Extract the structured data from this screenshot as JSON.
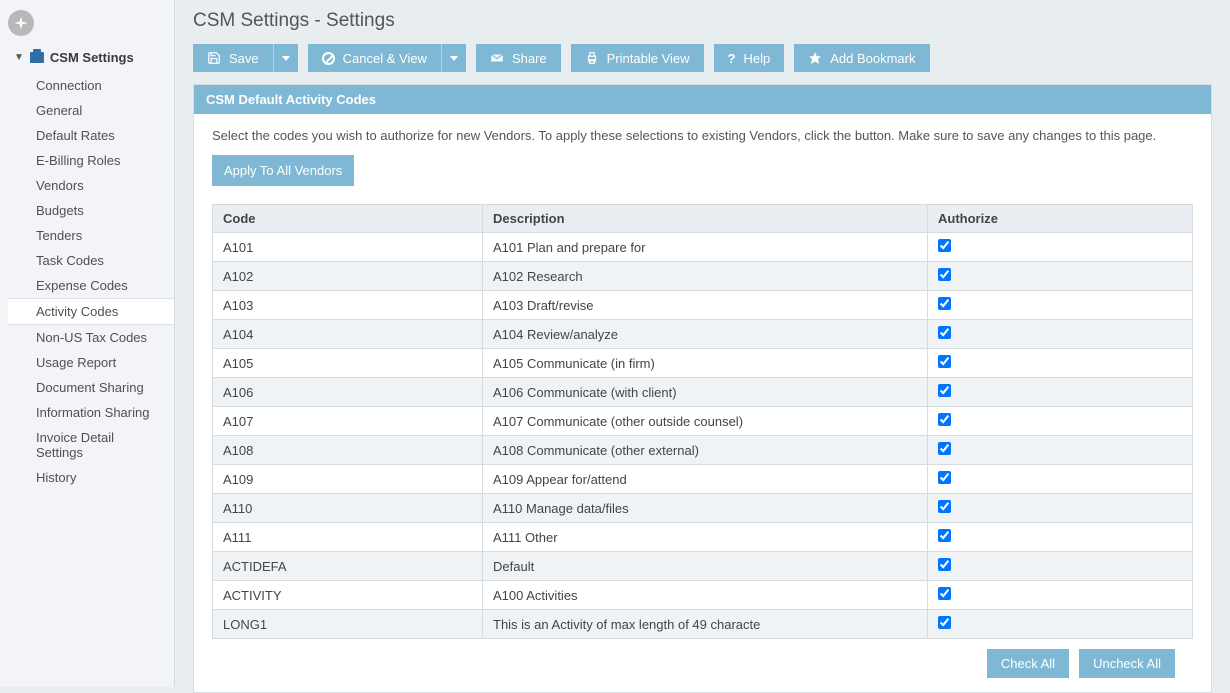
{
  "page": {
    "title": "CSM Settings - Settings"
  },
  "sidebar": {
    "root_label": "CSM Settings",
    "items": [
      {
        "label": "Connection"
      },
      {
        "label": "General"
      },
      {
        "label": "Default Rates"
      },
      {
        "label": "E-Billing Roles"
      },
      {
        "label": "Vendors"
      },
      {
        "label": "Budgets"
      },
      {
        "label": "Tenders"
      },
      {
        "label": "Task Codes"
      },
      {
        "label": "Expense Codes"
      },
      {
        "label": "Activity Codes"
      },
      {
        "label": "Non-US Tax Codes"
      },
      {
        "label": "Usage Report"
      },
      {
        "label": "Document Sharing"
      },
      {
        "label": "Information Sharing"
      },
      {
        "label": "Invoice Detail Settings"
      },
      {
        "label": "History"
      }
    ],
    "active_index": 9
  },
  "toolbar": {
    "save_label": "Save",
    "cancel_label": "Cancel & View",
    "share_label": "Share",
    "print_label": "Printable View",
    "help_label": "Help",
    "bookmark_label": "Add Bookmark"
  },
  "panel": {
    "header": "CSM Default Activity Codes",
    "instructions": "Select the codes you wish to authorize for new Vendors. To apply these selections to existing Vendors, click the button. Make sure to save any changes to this page.",
    "apply_label": "Apply To All Vendors",
    "columns": {
      "code": "Code",
      "description": "Description",
      "authorize": "Authorize"
    },
    "rows": [
      {
        "code": "A101",
        "description": "A101 Plan and prepare for",
        "authorize": true
      },
      {
        "code": "A102",
        "description": "A102 Research",
        "authorize": true
      },
      {
        "code": "A103",
        "description": "A103 Draft/revise",
        "authorize": true
      },
      {
        "code": "A104",
        "description": "A104 Review/analyze",
        "authorize": true
      },
      {
        "code": "A105",
        "description": "A105 Communicate (in firm)",
        "authorize": true
      },
      {
        "code": "A106",
        "description": "A106 Communicate (with client)",
        "authorize": true
      },
      {
        "code": "A107",
        "description": "A107 Communicate (other outside counsel)",
        "authorize": true
      },
      {
        "code": "A108",
        "description": "A108 Communicate (other external)",
        "authorize": true
      },
      {
        "code": "A109",
        "description": "A109 Appear for/attend",
        "authorize": true
      },
      {
        "code": "A110",
        "description": "A110 Manage data/files",
        "authorize": true
      },
      {
        "code": "A111",
        "description": "A111 Other",
        "authorize": true
      },
      {
        "code": "ACTIDEFA",
        "description": "Default",
        "authorize": true
      },
      {
        "code": "ACTIVITY",
        "description": "A100 Activities",
        "authorize": true
      },
      {
        "code": "LONG1",
        "description": "This is an Activity of max length of 49 characte",
        "authorize": true
      }
    ],
    "check_all_label": "Check All",
    "uncheck_all_label": "Uncheck All"
  }
}
